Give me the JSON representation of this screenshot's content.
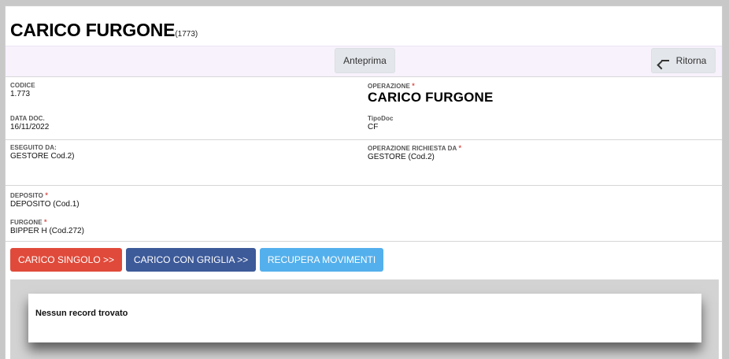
{
  "header": {
    "title": "CARICO FURGONE",
    "code": "(1773)"
  },
  "toolbar": {
    "preview_label": "Anteprima",
    "back_label": "Ritorna"
  },
  "fields": {
    "codice": {
      "label": "CODICE",
      "value": "1.773"
    },
    "operazione": {
      "label": "OPERAZIONE",
      "required": "*",
      "value": "CARICO FURGONE"
    },
    "data_doc": {
      "label": "DATA DOC.",
      "value": "16/11/2022"
    },
    "tipo_doc": {
      "label": "TipoDoc",
      "value": "CF"
    },
    "eseguito_da": {
      "label": "ESEGUITO DA:",
      "value": "GESTORE Cod.2)"
    },
    "richiesta_da": {
      "label": "OPERAZIONE RICHIESTA DA",
      "required": "*",
      "value": "GESTORE (Cod.2)"
    },
    "deposito": {
      "label": "DEPOSITO",
      "required": "*",
      "value": "DEPOSITO (Cod.1)"
    },
    "furgone": {
      "label": "FURGONE",
      "required": "*",
      "value": "BIPPER H (Cod.272)"
    }
  },
  "actions": {
    "carico_singolo": "CARICO SINGOLO >>",
    "carico_griglia": "CARICO CON GRIGLIA >>",
    "recupera": "RECUPERA MOVIMENTI"
  },
  "grid": {
    "empty_message": "Nessun record trovato"
  },
  "colors": {
    "red_button": "#e04a3a",
    "blue_button": "#3d5a99",
    "light_blue_button": "#54b0ec",
    "toolbar_bg": "#f7f2fc",
    "required_marker": "#d9534f"
  }
}
